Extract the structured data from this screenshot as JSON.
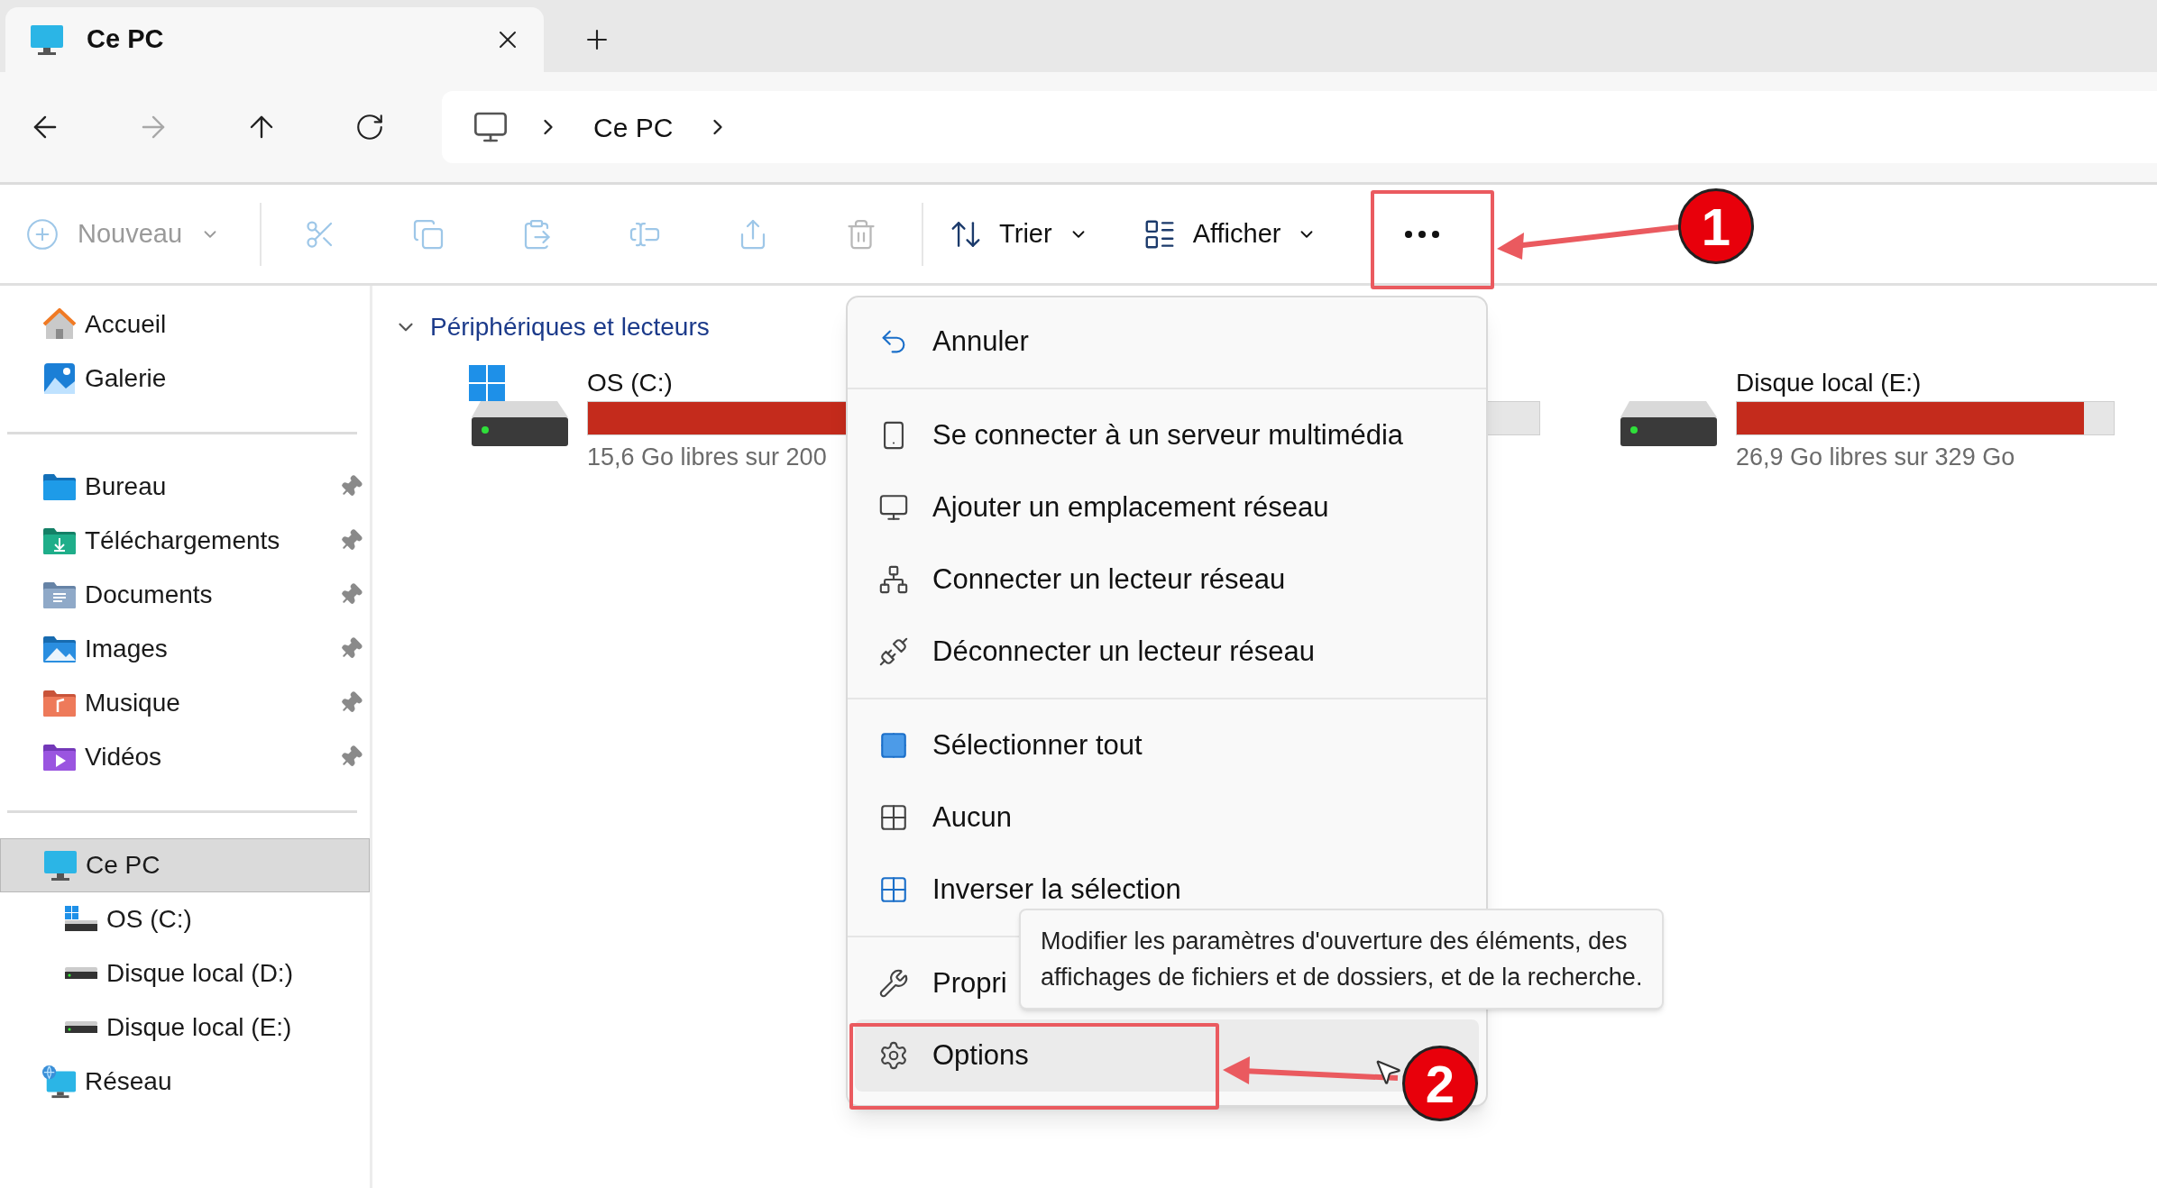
{
  "tab": {
    "title": "Ce PC",
    "selected": true
  },
  "address": {
    "path": [
      "Ce PC"
    ]
  },
  "toolbar": {
    "new": {
      "label": "Nouveau",
      "disabled": true
    },
    "actions": [
      {
        "kind": "cut",
        "disabled": true
      },
      {
        "kind": "copy",
        "disabled": true
      },
      {
        "kind": "paste",
        "disabled": true
      },
      {
        "kind": "rename",
        "disabled": true
      },
      {
        "kind": "share",
        "disabled": true
      },
      {
        "kind": "delete",
        "disabled": true
      }
    ],
    "sort": {
      "label": "Trier"
    },
    "view": {
      "label": "Afficher"
    }
  },
  "sidebar": {
    "groups": [
      [
        {
          "label": "Accueil",
          "kind": "home",
          "pinned": false,
          "selected": false
        },
        {
          "label": "Galerie",
          "kind": "gallery",
          "pinned": false,
          "selected": false
        }
      ],
      [
        {
          "label": "Bureau",
          "kind": "desktop",
          "pinned": true,
          "selected": false
        },
        {
          "label": "Téléchargements",
          "kind": "downloads",
          "pinned": true,
          "selected": false
        },
        {
          "label": "Documents",
          "kind": "documents",
          "pinned": true,
          "selected": false
        },
        {
          "label": "Images",
          "kind": "pictures",
          "pinned": true,
          "selected": false
        },
        {
          "label": "Musique",
          "kind": "music",
          "pinned": true,
          "selected": false
        },
        {
          "label": "Vidéos",
          "kind": "videos",
          "pinned": true,
          "selected": false
        }
      ],
      [
        {
          "label": "Ce PC",
          "kind": "pc",
          "pinned": false,
          "selected": true,
          "children": [
            {
              "label": "OS (C:)",
              "kind": "system_drive",
              "pinned": false,
              "selected": false
            },
            {
              "label": "Disque local (D:)",
              "kind": "drive",
              "pinned": false,
              "selected": false
            },
            {
              "label": "Disque local (E:)",
              "kind": "drive",
              "pinned": false,
              "selected": false
            }
          ]
        },
        {
          "label": "Réseau",
          "kind": "network",
          "pinned": false,
          "selected": false
        }
      ]
    ]
  },
  "section": {
    "title": "Périphériques et lecteurs",
    "expanded": true
  },
  "drives": [
    {
      "name": "OS (C:)",
      "kind": "system",
      "level": 0.92,
      "free": "15,6 Go libres sur 200"
    },
    {
      "name": "Disque local (E:)",
      "kind": "local",
      "level": 0.92,
      "free": "26,9 Go libres sur 329 Go"
    }
  ],
  "menu": {
    "groups": [
      [
        {
          "label": "Annuler",
          "kind": "undo",
          "highlighted": false
        }
      ],
      [
        {
          "label": "Se connecter à un serveur multimédia",
          "kind": "media",
          "highlighted": false
        },
        {
          "label": "Ajouter un emplacement réseau",
          "kind": "add_location",
          "highlighted": false
        },
        {
          "label": "Connecter un lecteur réseau",
          "kind": "map_drive",
          "highlighted": false
        },
        {
          "label": "Déconnecter un lecteur réseau",
          "kind": "disconnect",
          "highlighted": false
        }
      ],
      [
        {
          "label": "Sélectionner tout",
          "kind": "select_all",
          "highlighted": false
        },
        {
          "label": "Aucun",
          "kind": "select_none",
          "highlighted": false
        },
        {
          "label": "Inverser la sélection",
          "kind": "invert",
          "highlighted": false
        }
      ],
      [
        {
          "label": "Propri",
          "kind": "properties",
          "highlighted": false
        },
        {
          "label": "Options",
          "kind": "options",
          "highlighted": true
        }
      ]
    ]
  },
  "tooltip": {
    "lines": [
      "Modifier les paramètres d'ouverture des éléments, des",
      "affichages de fichiers et de dossiers, et de la recherche."
    ]
  },
  "callouts": [
    {
      "number": "1"
    },
    {
      "number": "2"
    }
  ]
}
